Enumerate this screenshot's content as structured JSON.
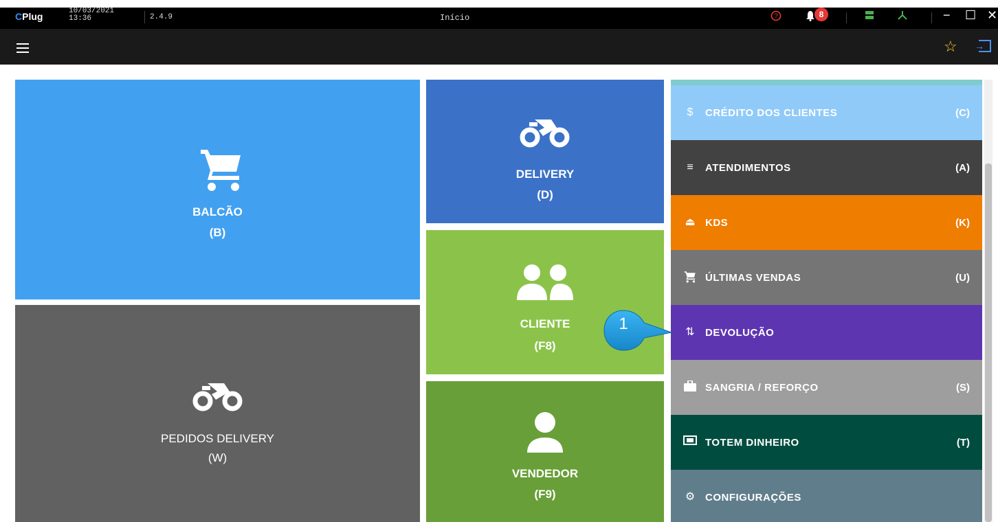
{
  "titlebar": {
    "logo": "Plug",
    "logo_prefix": "C",
    "date": "10/03/2021",
    "time": "13:36",
    "version": "2.4.9",
    "title": "Início",
    "notifications": "8",
    "minimize": "−",
    "maximize": "☐",
    "close": "✕"
  },
  "menubar": {
    "favorites_icon": "star-icon",
    "exit_icon": "exit-icon"
  },
  "tiles": {
    "balcao": {
      "label": "BALCÃO",
      "key": "(B)",
      "icon": "cart-icon"
    },
    "pedidos_delivery": {
      "label": "PEDIDOS DELIVERY",
      "key": "(W)",
      "icon": "bike-icon"
    },
    "delivery": {
      "label": "DELIVERY",
      "key": "(D)",
      "icon": "bike-icon"
    },
    "cliente": {
      "label": "CLIENTE",
      "key": "(F8)",
      "icon": "people-icon"
    },
    "vendedor": {
      "label": "VENDEDOR",
      "key": "(F9)",
      "icon": "person-icon"
    }
  },
  "side_menu": [
    {
      "label": "CRÉDITO DOS CLIENTES",
      "key": "(C)",
      "icon": "$",
      "color": "#90caf9"
    },
    {
      "label": "ATENDIMENTOS",
      "key": "(A)",
      "icon": "≡",
      "color": "#424242"
    },
    {
      "label": "KDS",
      "key": "(K)",
      "icon": "⏏",
      "color": "#ef7d00"
    },
    {
      "label": "ÚLTIMAS VENDAS",
      "key": "(U)",
      "icon": "🛒",
      "color": "#757575"
    },
    {
      "label": "DEVOLUÇÃO",
      "key": "",
      "icon": "⇅",
      "color": "#5e35b1"
    },
    {
      "label": "SANGRIA / REFORÇO",
      "key": "(S)",
      "icon": "▆",
      "color": "#9e9e9e"
    },
    {
      "label": "TOTEM DINHEIRO",
      "key": "(T)",
      "icon": "▦",
      "color": "#004d40"
    },
    {
      "label": "CONFIGURAÇÕES",
      "key": "",
      "icon": "⚙",
      "color": "#607d8b"
    }
  ],
  "callout": {
    "number": "1"
  }
}
